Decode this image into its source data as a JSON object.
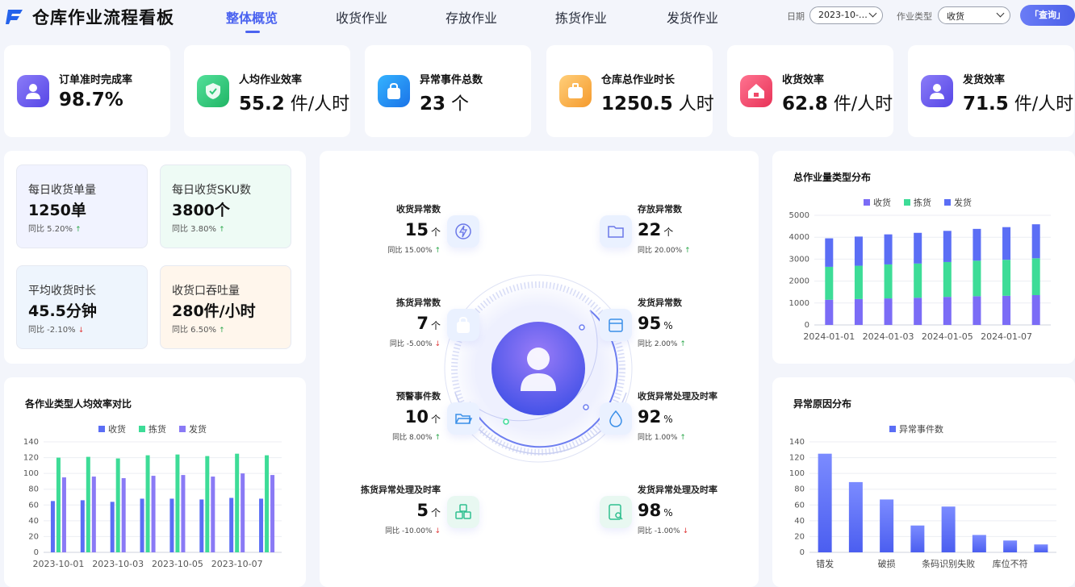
{
  "app": {
    "title": "仓库作业流程看板"
  },
  "nav": {
    "tabs": [
      {
        "label": "整体概览",
        "active": true
      },
      {
        "label": "收货作业",
        "active": false
      },
      {
        "label": "存放作业",
        "active": false
      },
      {
        "label": "拣货作业",
        "active": false
      },
      {
        "label": "发货作业",
        "active": false
      }
    ]
  },
  "filters": {
    "date_label": "日期",
    "date_value": "2023-10-…",
    "type_label": "作业类型",
    "type_value": "收货",
    "query_label": "「查询」"
  },
  "kpis": [
    {
      "label": "订单准时完成率",
      "value": "98.7%",
      "unit": "",
      "icon": "user-icon",
      "color": "#6b5cf0"
    },
    {
      "label": "人均作业效率",
      "value": "55.2",
      "unit": " 件/人时",
      "icon": "shield-check-icon",
      "color": "#2fc878"
    },
    {
      "label": "异常事件总数",
      "value": "23",
      "unit": " 个",
      "icon": "bag-icon",
      "color": "#1e8ff5"
    },
    {
      "label": "仓库总作业时长",
      "value": "1250.5",
      "unit": " 人时",
      "icon": "briefcase-icon",
      "color": "#f5a742"
    },
    {
      "label": "收货效率",
      "value": "62.8",
      "unit": " 件/人时",
      "icon": "house-icon",
      "color": "#f04868"
    },
    {
      "label": "发货效率",
      "value": "71.5",
      "unit": " 件/人时",
      "icon": "user-icon",
      "color": "#6b5cf0"
    }
  ],
  "stats": [
    {
      "label": "每日收货单量",
      "value": "1250单",
      "change": "同比 5.20%",
      "dir": "up",
      "bg": "#f1f3ff"
    },
    {
      "label": "每日收货SKU数",
      "value": "3800个",
      "change": "同比 3.80%",
      "dir": "up",
      "bg": "#eefbf5"
    },
    {
      "label": "平均收货时长",
      "value": "45.5分钟",
      "change": "同比 -2.10%",
      "dir": "down",
      "bg": "#eef5fd"
    },
    {
      "label": "收货口吞吐量",
      "value": "280件/小时",
      "change": "同比 6.50%",
      "dir": "up",
      "bg": "#fff6ec"
    }
  ],
  "exceptions": [
    {
      "label": "收货异常数",
      "value": "15",
      "unit": "个",
      "change": "同比 15.00%",
      "dir": "up",
      "side": "l",
      "icon": "lightning-icon"
    },
    {
      "label": "存放异常数",
      "value": "22",
      "unit": "个",
      "change": "同比 20.00%",
      "dir": "up",
      "side": "r",
      "icon": "folder-icon"
    },
    {
      "label": "拣货异常数",
      "value": "7",
      "unit": "个",
      "change": "同比 -5.00%",
      "dir": "down",
      "side": "l",
      "icon": "bag-icon"
    },
    {
      "label": "发货异常数",
      "value": "95",
      "unit": "%",
      "change": "同比 2.00%",
      "dir": "up",
      "side": "r",
      "icon": "store-icon"
    },
    {
      "label": "预警事件数",
      "value": "10",
      "unit": "个",
      "change": "同比 8.00%",
      "dir": "up",
      "side": "l",
      "icon": "folder-open-icon"
    },
    {
      "label": "收货异常处理及时率",
      "value": "92",
      "unit": "%",
      "change": "同比 1.00%",
      "dir": "up",
      "side": "r",
      "icon": "drop-icon"
    },
    {
      "label": "拣货异常处理及时率",
      "value": "5",
      "unit": "个",
      "change": "同比 -10.00%",
      "dir": "down",
      "side": "l",
      "icon": "boxes-icon"
    },
    {
      "label": "发货异常处理及时率",
      "value": "98",
      "unit": "%",
      "change": "同比 -1.00%",
      "dir": "down",
      "side": "r",
      "icon": "doc-search-icon"
    }
  ],
  "chart_data": [
    {
      "type": "bar",
      "stacked": true,
      "title": "总作业量类型分布",
      "categories": [
        "2024-01-01",
        "2024-01-02",
        "2024-01-03",
        "2024-01-04",
        "2024-01-05",
        "2024-01-06",
        "2024-01-07",
        "2024-01-08"
      ],
      "tick_labels": [
        "2024-01-01",
        "2024-01-03",
        "2024-01-05",
        "2024-01-07"
      ],
      "series": [
        {
          "name": "收货",
          "values": [
            1150,
            1180,
            1210,
            1240,
            1280,
            1310,
            1330,
            1360
          ],
          "color": "#7b6cf6"
        },
        {
          "name": "拣货",
          "values": [
            1500,
            1520,
            1550,
            1560,
            1590,
            1620,
            1640,
            1680
          ],
          "color": "#3ddc97"
        },
        {
          "name": "发货",
          "values": [
            1300,
            1330,
            1370,
            1400,
            1420,
            1450,
            1490,
            1550
          ],
          "color": "#5b6ef5"
        }
      ],
      "ylim": [
        0,
        5000
      ],
      "yticks": [
        0,
        1000,
        2000,
        3000,
        4000,
        5000
      ],
      "legend": "top"
    },
    {
      "type": "bar",
      "title": "各作业类型人均效率对比",
      "categories": [
        "2023-10-01",
        "2023-10-02",
        "2023-10-03",
        "2023-10-04",
        "2023-10-05",
        "2023-10-06",
        "2023-10-07",
        "2023-10-08"
      ],
      "tick_labels": [
        "2023-10-01",
        "2023-10-03",
        "2023-10-05",
        "2023-10-07"
      ],
      "series": [
        {
          "name": "收货",
          "values": [
            65,
            66,
            64,
            68,
            68,
            67,
            69,
            68
          ],
          "color": "#5b6ef5"
        },
        {
          "name": "拣货",
          "values": [
            120,
            121,
            119,
            123,
            124,
            122,
            125,
            123
          ],
          "color": "#3ddc97"
        },
        {
          "name": "发货",
          "values": [
            95,
            96,
            94,
            97,
            98,
            96,
            100,
            98
          ],
          "color": "#8a7af5"
        }
      ],
      "ylim": [
        0,
        140
      ],
      "yticks": [
        0,
        20,
        40,
        60,
        80,
        100,
        120,
        140
      ],
      "legend": "top"
    },
    {
      "type": "bar",
      "title": "异常原因分布",
      "categories": [
        "错发",
        "",
        "破损",
        "",
        "条码识别失败",
        "",
        "库位不符",
        ""
      ],
      "series": [
        {
          "name": "异常事件数",
          "values": [
            125,
            89,
            67,
            34,
            58,
            22,
            15,
            10
          ],
          "color": "#5b6ef5"
        }
      ],
      "ylim": [
        0,
        140
      ],
      "yticks": [
        0,
        20,
        40,
        60,
        80,
        100,
        120,
        140
      ],
      "legend": "top"
    }
  ]
}
